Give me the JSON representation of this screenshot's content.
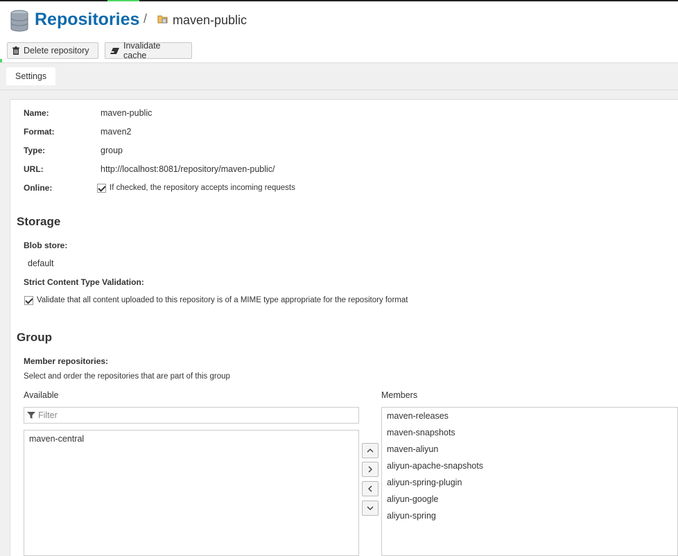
{
  "header": {
    "title": "Repositories",
    "separator": "/",
    "repo_name": "maven-public"
  },
  "toolbar": {
    "delete_label": "Delete repository",
    "invalidate_label": "Invalidate cache"
  },
  "tabs": [
    {
      "label": "Settings"
    }
  ],
  "settings": {
    "name_label": "Name:",
    "name_value": "maven-public",
    "format_label": "Format:",
    "format_value": "maven2",
    "type_label": "Type:",
    "type_value": "group",
    "url_label": "URL:",
    "url_value": "http://localhost:8081/repository/maven-public/",
    "online_label": "Online:",
    "online_text": "If checked, the repository accepts incoming requests",
    "online_checked": true
  },
  "storage": {
    "heading": "Storage",
    "blob_label": "Blob store:",
    "blob_value": "default",
    "strict_label": "Strict Content Type Validation:",
    "strict_text": "Validate that all content uploaded to this repository is of a MIME type appropriate for the repository format",
    "strict_checked": true
  },
  "group": {
    "heading": "Group",
    "member_label": "Member repositories:",
    "member_help": "Select and order the repositories that are part of this group",
    "available_header": "Available",
    "members_header": "Members",
    "filter_placeholder": "Filter",
    "available": [
      "maven-central"
    ],
    "members": [
      "maven-releases",
      "maven-snapshots",
      "maven-aliyun",
      "aliyun-apache-snapshots",
      "aliyun-spring-plugin",
      "aliyun-google",
      "aliyun-spring"
    ]
  },
  "colors": {
    "accent_blue": "#0d6aad",
    "accent_green": "#4cd964"
  }
}
